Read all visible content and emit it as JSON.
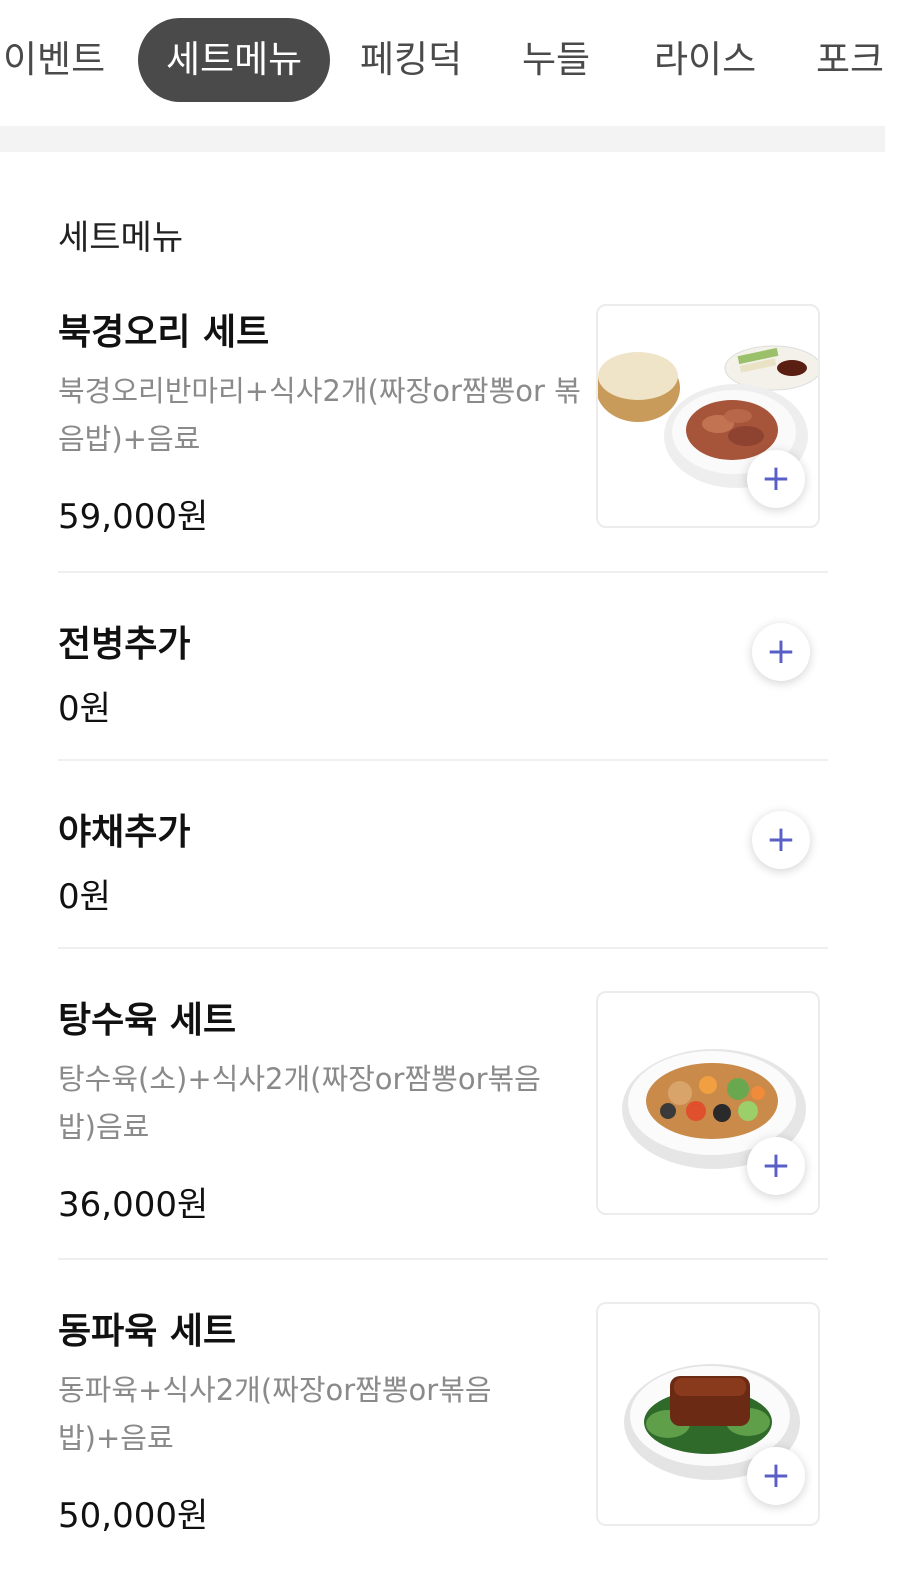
{
  "tabs": [
    "이벤트",
    "세트메뉴",
    "페킹덕",
    "누들",
    "라이스",
    "포크"
  ],
  "active_tab": "세트메뉴",
  "section": {
    "title": "세트메뉴"
  },
  "items": [
    {
      "name": "북경오리 세트",
      "desc": "북경오리반마리+식사2개(짜장or짬뽕or 볶음밥)+음료",
      "price": "59,000원",
      "image": "peking-duck-set"
    },
    {
      "name": "전병추가",
      "price": "0원"
    },
    {
      "name": "야채추가",
      "price": "0원"
    },
    {
      "name": "탕수육 세트",
      "desc": "탕수육(소)+식사2개(짜장or짬뽕or볶음 밥)음료",
      "price": "36,000원",
      "image": "sweet-sour-pork-set"
    },
    {
      "name": "동파육 세트",
      "desc": "동파육+식사2개(짜장or짬뽕or볶음 밥)+음료",
      "price": "50,000원",
      "image": "dongpo-pork-set"
    }
  ],
  "add_icon": "plus",
  "colors": {
    "active_tab_bg": "#4a4a4a",
    "accent": "#5a5fc8",
    "muted_text": "#8a8a8a"
  }
}
